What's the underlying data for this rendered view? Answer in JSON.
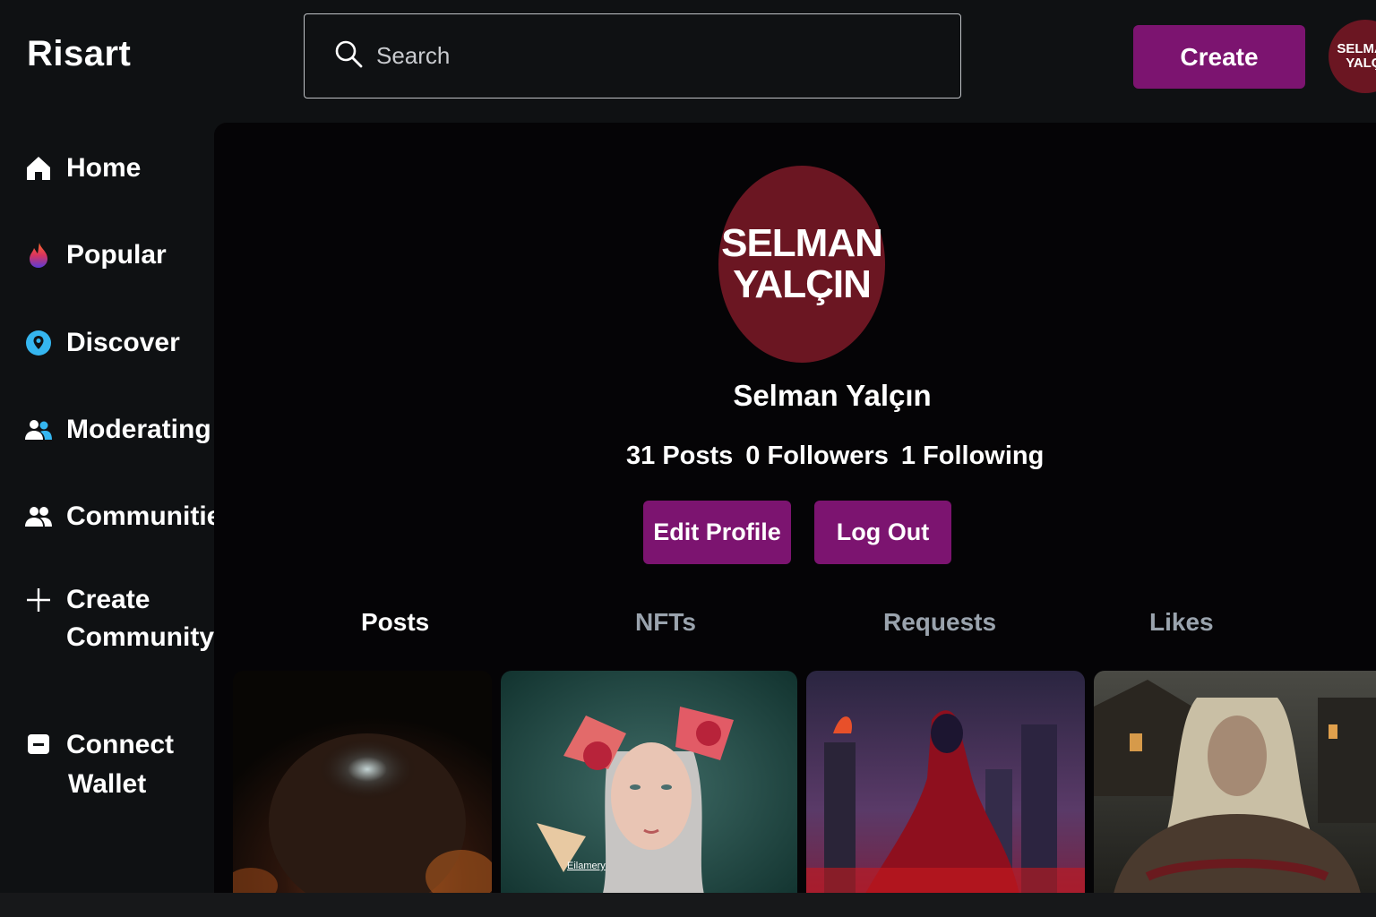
{
  "header": {
    "logo": "Risart",
    "search_placeholder": "Search",
    "create_label": "Create",
    "avatar_line1": "SELMAN",
    "avatar_line2": "YALÇI"
  },
  "sidebar": {
    "items": [
      {
        "label": "Home",
        "icon": "home-icon"
      },
      {
        "label": "Popular",
        "icon": "flame-icon"
      },
      {
        "label": "Discover",
        "icon": "location-pin-icon"
      },
      {
        "label": "Moderating",
        "icon": "users-icon"
      },
      {
        "label": "Communities",
        "icon": "group-icon"
      },
      {
        "label_line1": "Create",
        "label_line2": "Community",
        "icon": "plus-icon"
      },
      {
        "label_line1": "Connect",
        "label_line2": "Wallet",
        "icon": "wallet-icon"
      }
    ]
  },
  "profile": {
    "avatar_line1": "SELMAN",
    "avatar_line2": "YALÇIN",
    "name": "Selman Yalçın",
    "posts": "31 Posts",
    "followers": "0 Followers",
    "following": "1 Following",
    "edit_label": "Edit Profile",
    "logout_label": "Log Out"
  },
  "tabs": [
    {
      "label": "Posts",
      "active": true
    },
    {
      "label": "NFTs",
      "active": false
    },
    {
      "label": "Requests",
      "active": false
    },
    {
      "label": "Likes",
      "active": false
    }
  ],
  "posts": [
    {
      "name": "portrait-dark-post"
    },
    {
      "name": "elf-portrait-post",
      "watermark": "Eilamery"
    },
    {
      "name": "hooded-figure-post"
    },
    {
      "name": "warrior-portrait-post"
    }
  ],
  "colors": {
    "accent": "#7c1470",
    "avatar_bg": "#6b1622",
    "background": "#0f1113",
    "panel": "#050406",
    "tab_inactive": "#9aa3ad"
  }
}
